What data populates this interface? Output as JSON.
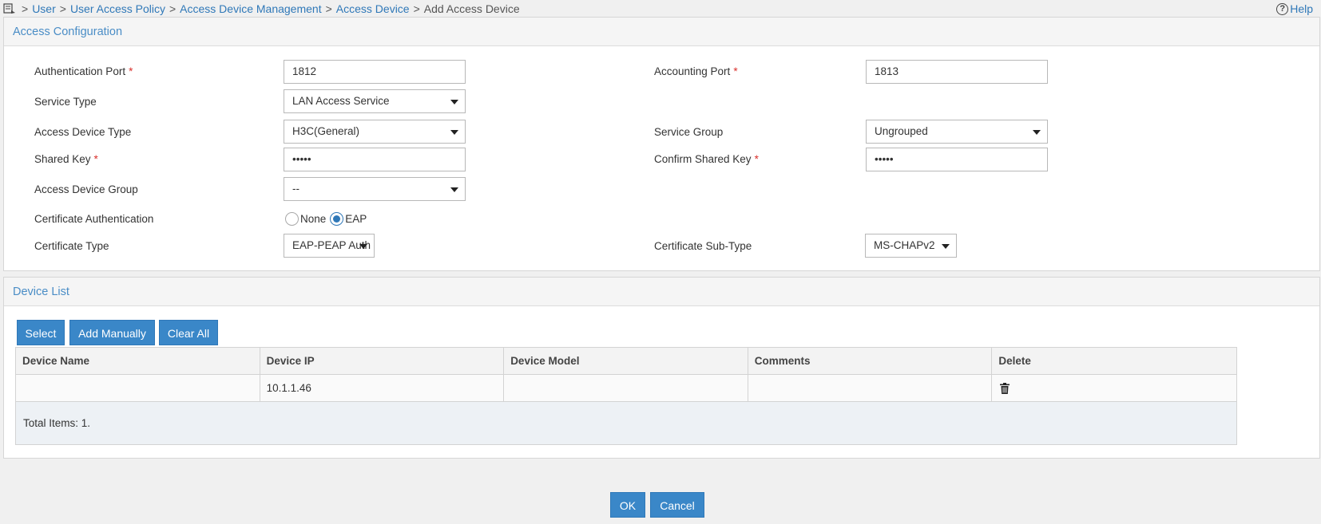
{
  "breadcrumb": {
    "items": [
      "User",
      "User Access Policy",
      "Access Device Management",
      "Access Device"
    ],
    "current": "Add Access Device",
    "separator": ">"
  },
  "help": {
    "label": "Help",
    "icon": "help-circle-icon"
  },
  "access_config": {
    "title": "Access Configuration",
    "required_mark": "*",
    "auth_port": {
      "label": "Authentication Port",
      "value": "1812"
    },
    "acct_port": {
      "label": "Accounting Port",
      "value": "1813"
    },
    "service_type": {
      "label": "Service Type",
      "value": "LAN Access Service"
    },
    "device_type": {
      "label": "Access Device Type",
      "value": "H3C(General)"
    },
    "service_group": {
      "label": "Service Group",
      "value": "Ungrouped"
    },
    "shared_key": {
      "label": "Shared Key",
      "value": "•••••"
    },
    "confirm_key": {
      "label": "Confirm Shared Key",
      "value": "•••••"
    },
    "device_group": {
      "label": "Access Device Group",
      "value": "--"
    },
    "cert_auth": {
      "label": "Certificate Authentication",
      "options": [
        "None",
        "EAP"
      ],
      "selected": "EAP"
    },
    "cert_type": {
      "label": "Certificate Type",
      "value": "EAP-PEAP Auth"
    },
    "cert_subtype": {
      "label": "Certificate Sub-Type",
      "value": "MS-CHAPv2"
    }
  },
  "device_list": {
    "title": "Device List",
    "buttons": {
      "select": "Select",
      "add_manually": "Add Manually",
      "clear_all": "Clear All"
    },
    "columns": [
      "Device Name",
      "Device IP",
      "Device Model",
      "Comments",
      "Delete"
    ],
    "rows": [
      {
        "name": "",
        "ip": "10.1.1.46",
        "model": "",
        "comments": "",
        "delete_icon": "trash-icon"
      }
    ],
    "total": "Total Items: 1."
  },
  "footer": {
    "ok": "OK",
    "cancel": "Cancel"
  },
  "colors": {
    "accent": "#3a87c8",
    "link": "#2f78b8",
    "title": "#4a8dc6",
    "required": "#d9302c"
  }
}
